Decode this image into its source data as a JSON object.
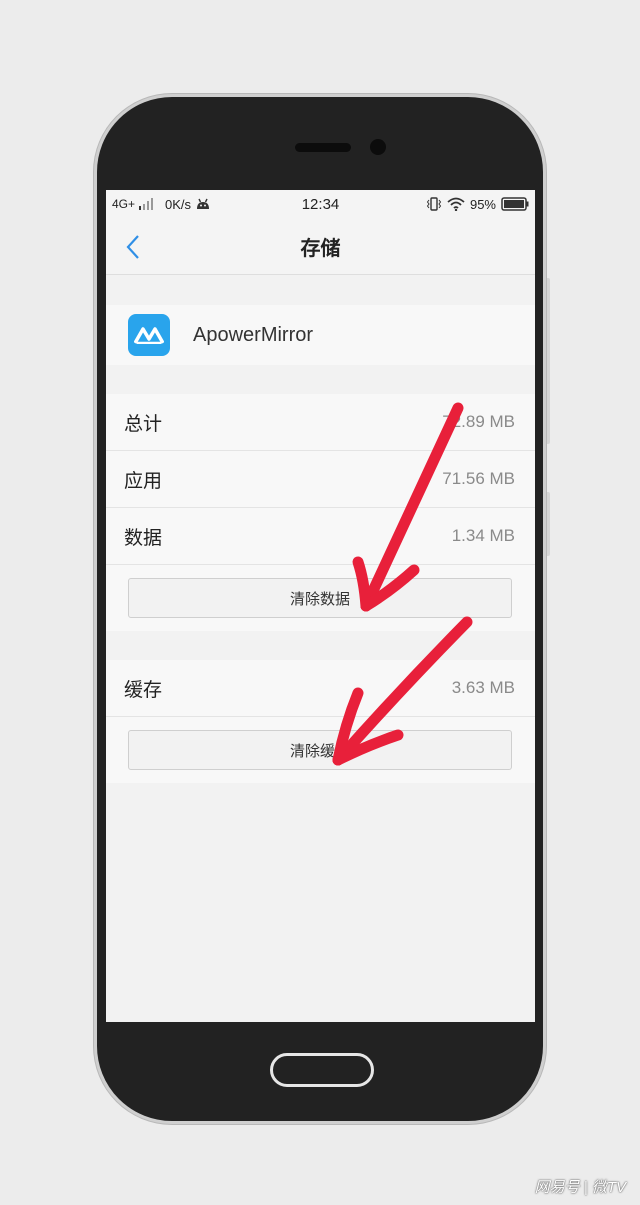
{
  "status_bar": {
    "network": "4G+",
    "speed": "0K/s",
    "time": "12:34",
    "battery": "95%"
  },
  "header": {
    "title": "存储"
  },
  "app": {
    "name": "ApowerMirror",
    "icon": "apowermirror-logo-icon",
    "icon_color": "#29a4ec"
  },
  "storage": {
    "total_label": "总计",
    "total_value": "72.89 MB",
    "app_label": "应用",
    "app_value": "71.56 MB",
    "data_label": "数据",
    "data_value": "1.34 MB",
    "clear_data_button": "清除数据"
  },
  "cache": {
    "label": "缓存",
    "value": "3.63 MB",
    "clear_cache_button": "清除缓存"
  },
  "annotation": {
    "arrow_color": "#e8203a"
  },
  "watermark": {
    "text": "网易号 | 微TV"
  }
}
